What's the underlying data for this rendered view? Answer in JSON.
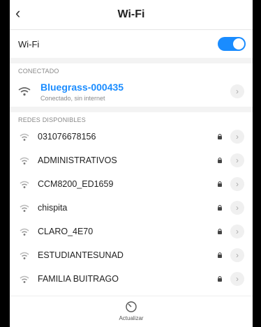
{
  "header": {
    "back_icon": "chevron-left-icon",
    "title": "Wi-Fi"
  },
  "wifi_toggle": {
    "label": "Wi-Fi",
    "state": "on",
    "accent": "#1a8cff"
  },
  "connected": {
    "section_label": "CONECTADO",
    "network": {
      "name": "Bluegrass-000435",
      "status": "Conectado, sin internet"
    }
  },
  "available": {
    "section_label": "REDES DISPONIBLES",
    "networks": [
      {
        "name": "031076678156",
        "secured": true
      },
      {
        "name": "ADMINISTRATIVOS",
        "secured": true
      },
      {
        "name": "CCM8200_ED1659",
        "secured": true
      },
      {
        "name": "chispita",
        "secured": true
      },
      {
        "name": "CLARO_4E70",
        "secured": true
      },
      {
        "name": "ESTUDIANTESUNAD",
        "secured": true
      },
      {
        "name": "FAMILIA BUITRAGO",
        "secured": true
      }
    ]
  },
  "footer": {
    "refresh_label": "Actualizar",
    "refresh_icon": "refresh-icon"
  }
}
